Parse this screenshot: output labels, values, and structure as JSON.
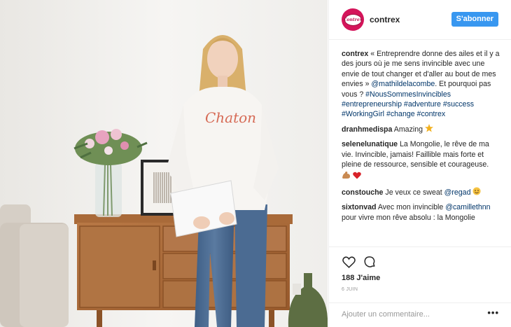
{
  "post": {
    "username": "contrex",
    "follow_label": "S'abonner",
    "avatar_text": "Contrex",
    "image_text": "Chaton"
  },
  "caption": {
    "username": "contrex",
    "text": "« Entreprendre donne des ailes et il y a des jours où je me sens invincible avec une envie de tout changer et d'aller au bout de mes envies » ",
    "mention": "@mathildelacombe",
    "text2": ". Et pourquoi pas vous ? ",
    "tags": "#NousSommesInvincibles #entrepreneurship #adventure #success #WorkingGirl #change #contrex"
  },
  "comments": [
    {
      "user": "dranhmedispa",
      "text": "Amazing "
    },
    {
      "user": "selenelunatique",
      "text": "La Mongolie, le rêve de ma vie. Invincible, jamais! Faillible mais forte et pleine de ressource, sensible et courageuse."
    },
    {
      "user": "constouche",
      "text": "Je veux ce sweat ",
      "mention": "@regad"
    },
    {
      "user": "sixtonvad",
      "text": "Avec mon invincible ",
      "mention": "@camillethnn",
      "text2": " pour vivre mon rêve absolu : la Mongolie"
    }
  ],
  "footer": {
    "likes": "188 J'aime",
    "date": "6 JUIN",
    "add_comment_placeholder": "Ajouter un commentaire...",
    "more_label": "•••"
  },
  "icons": [
    "heart-icon",
    "comment-icon",
    "star-emoji-icon",
    "flexed-biceps-emoji-icon",
    "red-heart-emoji-icon",
    "smiling-face-emoji-icon"
  ],
  "colors": {
    "brand": "#d4145a",
    "follow": "#3897f0",
    "link": "#003569"
  }
}
